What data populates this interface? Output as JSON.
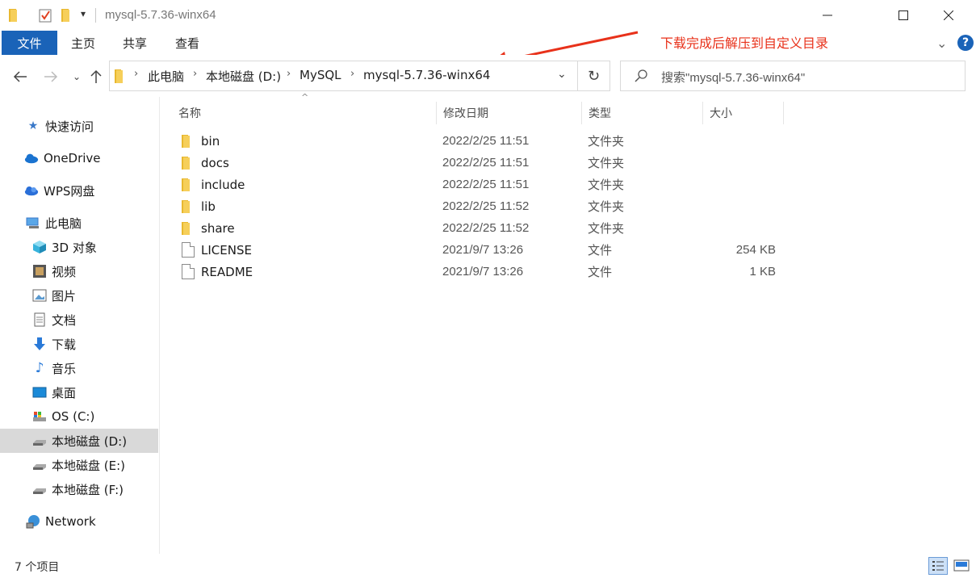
{
  "window": {
    "title": "mysql-5.7.36-winx64",
    "minimize_icon": "minimize-icon",
    "maximize_icon": "maximize-icon",
    "close_icon": "close-icon"
  },
  "ribbon": {
    "tabs": [
      {
        "label": "文件"
      },
      {
        "label": "主页"
      },
      {
        "label": "共享"
      },
      {
        "label": "查看"
      }
    ],
    "annotation": "下载完成后解压到自定义目录",
    "annotation_color": "#e8311a",
    "accent_color": "#1a63b8"
  },
  "address": {
    "breadcrumbs": [
      "此电脑",
      "本地磁盘 (D:)",
      "MySQL",
      "mysql-5.7.36-winx64"
    ]
  },
  "search": {
    "placeholder": "搜索\"mysql-5.7.36-winx64\""
  },
  "sidebar": {
    "items": [
      {
        "label": "快速访问",
        "icon": "star-icon"
      },
      {
        "label": "OneDrive",
        "icon": "cloud-icon"
      },
      {
        "label": "WPS网盘",
        "icon": "cloud-icon"
      },
      {
        "label": "此电脑",
        "icon": "computer-icon"
      },
      {
        "label": "3D 对象",
        "icon": "cube-icon"
      },
      {
        "label": "视频",
        "icon": "video-icon"
      },
      {
        "label": "图片",
        "icon": "picture-icon"
      },
      {
        "label": "文档",
        "icon": "document-icon"
      },
      {
        "label": "下载",
        "icon": "download-icon"
      },
      {
        "label": "音乐",
        "icon": "music-icon"
      },
      {
        "label": "桌面",
        "icon": "desktop-icon"
      },
      {
        "label": "OS (C:)",
        "icon": "drive-icon"
      },
      {
        "label": "本地磁盘 (D:)",
        "icon": "drive-icon",
        "selected": true
      },
      {
        "label": "本地磁盘 (E:)",
        "icon": "drive-icon"
      },
      {
        "label": "本地磁盘 (F:)",
        "icon": "drive-icon"
      },
      {
        "label": "Network",
        "icon": "network-icon"
      }
    ]
  },
  "file_list": {
    "columns": [
      "名称",
      "修改日期",
      "类型",
      "大小"
    ],
    "rows": [
      {
        "name": "bin",
        "date": "2022/2/25 11:51",
        "type": "文件夹",
        "size": "",
        "kind": "folder"
      },
      {
        "name": "docs",
        "date": "2022/2/25 11:51",
        "type": "文件夹",
        "size": "",
        "kind": "folder"
      },
      {
        "name": "include",
        "date": "2022/2/25 11:51",
        "type": "文件夹",
        "size": "",
        "kind": "folder"
      },
      {
        "name": "lib",
        "date": "2022/2/25 11:52",
        "type": "文件夹",
        "size": "",
        "kind": "folder"
      },
      {
        "name": "share",
        "date": "2022/2/25 11:52",
        "type": "文件夹",
        "size": "",
        "kind": "folder"
      },
      {
        "name": "LICENSE",
        "date": "2021/9/7 13:26",
        "type": "文件",
        "size": "254 KB",
        "kind": "file"
      },
      {
        "name": "README",
        "date": "2021/9/7 13:26",
        "type": "文件",
        "size": "1 KB",
        "kind": "file"
      }
    ]
  },
  "status": {
    "item_count": "7 个项目"
  }
}
